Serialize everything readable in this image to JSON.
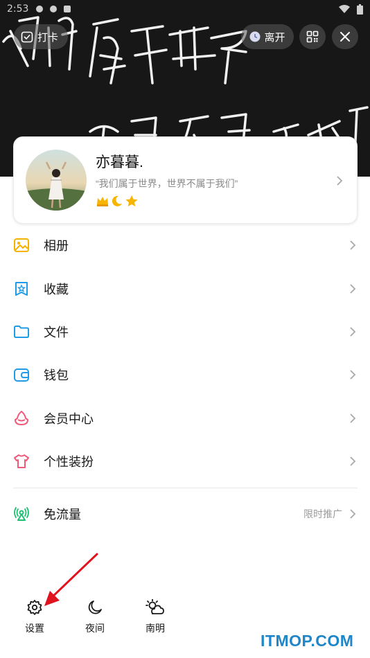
{
  "status_bar": {
    "time": "2:53"
  },
  "banner": {
    "checkin_label": "打卡",
    "away_label": "离开"
  },
  "profile": {
    "nickname": "亦暮暮.",
    "signature": "“我们属于世界，世界不属于我们”",
    "badges": [
      "crown-icon",
      "moon-icon",
      "star-icon"
    ]
  },
  "menu": {
    "items": [
      {
        "label": "相册",
        "icon": "album-icon"
      },
      {
        "label": "收藏",
        "icon": "favorites-icon"
      },
      {
        "label": "文件",
        "icon": "folder-icon"
      },
      {
        "label": "钱包",
        "icon": "wallet-icon"
      },
      {
        "label": "会员中心",
        "icon": "member-icon"
      },
      {
        "label": "个性装扮",
        "icon": "dressup-icon"
      }
    ],
    "free_data": {
      "label": "免流量",
      "promo": "限时推广"
    }
  },
  "bottom_bar": {
    "settings_label": "设置",
    "night_label": "夜间",
    "weather_label": "南明"
  },
  "watermark": "ITMOP.COM",
  "colors": {
    "album": "#f5b300",
    "favorites": "#1f9be8",
    "folder": "#1f9be8",
    "wallet": "#1f9be8",
    "member": "#f05a78",
    "dressup": "#f05a78",
    "free_data": "#1dbf73",
    "arrow": "#e0141e",
    "watermark": "#1f86c9"
  }
}
